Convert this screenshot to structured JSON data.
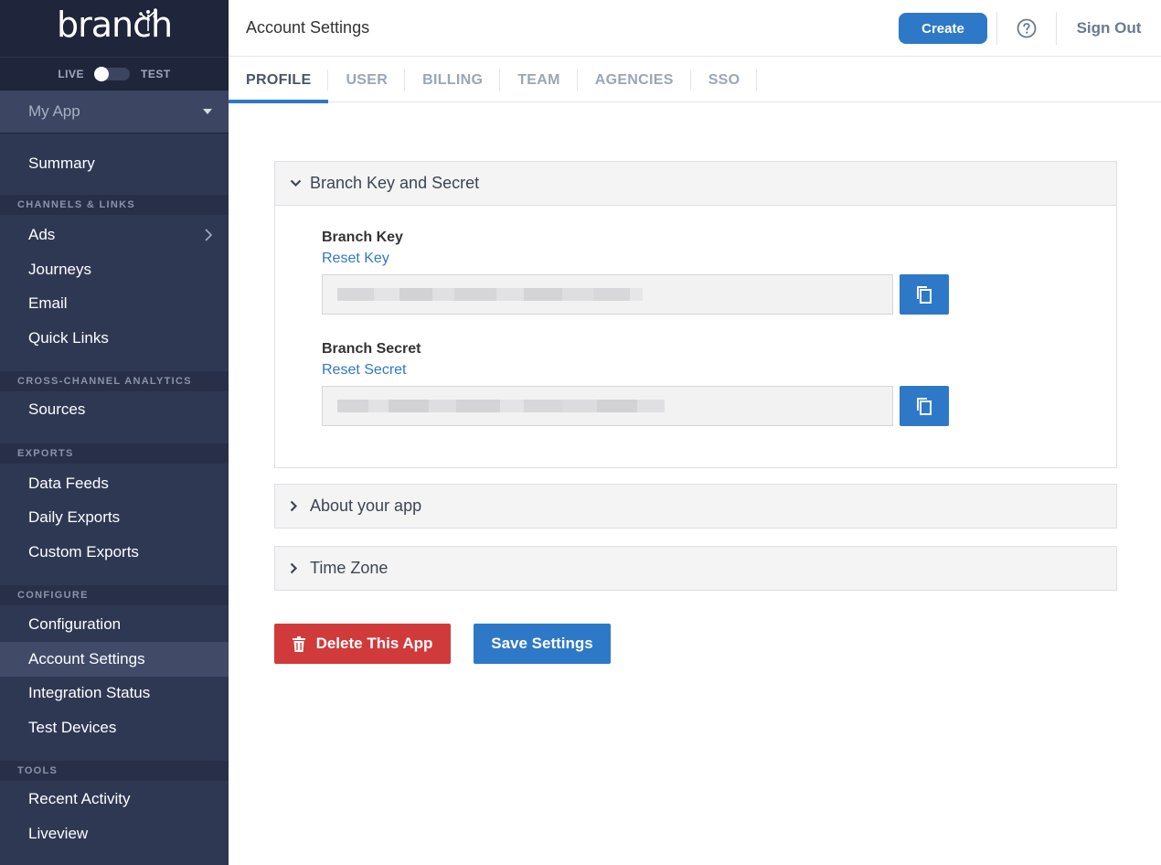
{
  "brand": {
    "logo_text": "branch"
  },
  "env_toggle": {
    "left_label": "LIVE",
    "right_label": "TEST"
  },
  "app_selector": {
    "value": "My App"
  },
  "sidebar": {
    "summary": "Summary",
    "sections": {
      "channels": "CHANNELS & LINKS",
      "analytics": "CROSS-CHANNEL ANALYTICS",
      "exports": "EXPORTS",
      "configure": "CONFIGURE",
      "tools": "TOOLS"
    },
    "channels_items": [
      "Ads",
      "Journeys",
      "Email",
      "Quick Links"
    ],
    "analytics_items": [
      "Sources"
    ],
    "exports_items": [
      "Data Feeds",
      "Daily Exports",
      "Custom Exports"
    ],
    "configure_items": [
      "Configuration",
      "Account Settings",
      "Integration Status",
      "Test Devices"
    ],
    "tools_items": [
      "Recent Activity",
      "Liveview"
    ]
  },
  "header": {
    "title": "Account Settings",
    "create_label": "Create",
    "signout_label": "Sign Out"
  },
  "tabs": [
    "PROFILE",
    "USER",
    "BILLING",
    "TEAM",
    "AGENCIES",
    "SSO"
  ],
  "active_tab": "PROFILE",
  "panels": {
    "key_secret": {
      "title": "Branch Key and Secret",
      "key_label": "Branch Key",
      "key_reset": "Reset Key",
      "secret_label": "Branch Secret",
      "secret_reset": "Reset Secret"
    },
    "about_title": "About your app",
    "timezone_title": "Time Zone"
  },
  "actions": {
    "delete_label": "Delete This App",
    "save_label": "Save Settings"
  },
  "colors": {
    "accent": "#2e78c8",
    "danger": "#d13a3a",
    "sidebar_bg": "#2f3853"
  }
}
